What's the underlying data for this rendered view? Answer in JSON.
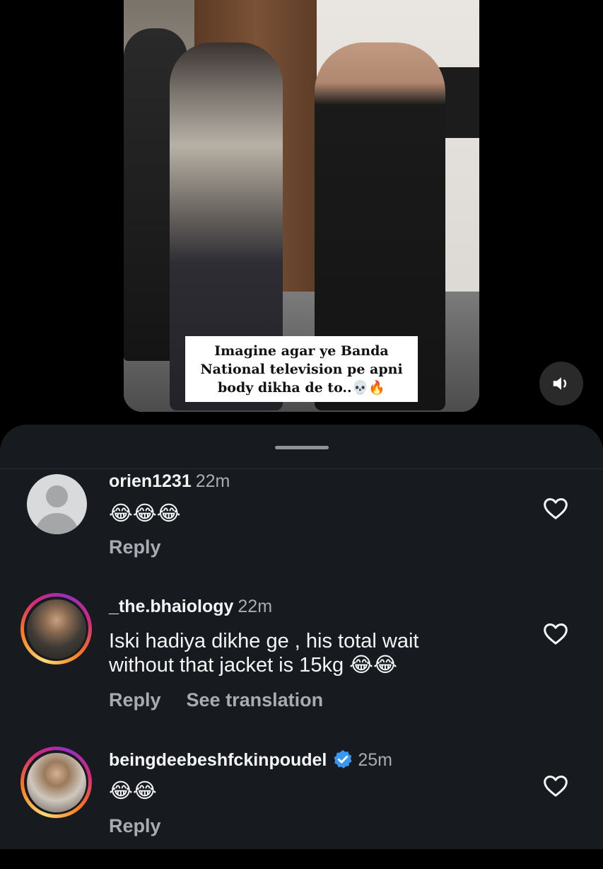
{
  "video": {
    "caption": "Imagine agar ye Banda\nNational television pe apni\nbody dikha de to..💀🔥"
  },
  "comments": [
    {
      "username": "orien1231",
      "time": "22m",
      "text": "😂😂😂",
      "reply_label": "Reply",
      "translate_label": "",
      "verified": false
    },
    {
      "username": "_the.bhaiology",
      "time": "22m",
      "text": "Iski hadiya dikhe ge , his total wait\nwithout that jacket is 15kg 😂😂",
      "reply_label": "Reply",
      "translate_label": "See translation",
      "verified": false
    },
    {
      "username": "beingdeebeshfckinpoudel",
      "time": "25m",
      "text": "😂😂",
      "reply_label": "Reply",
      "translate_label": "",
      "verified": true
    }
  ],
  "colors": {
    "sheet_bg": "#171b20",
    "verified_blue": "#3897f0",
    "muted_text": "#a8acb1"
  }
}
